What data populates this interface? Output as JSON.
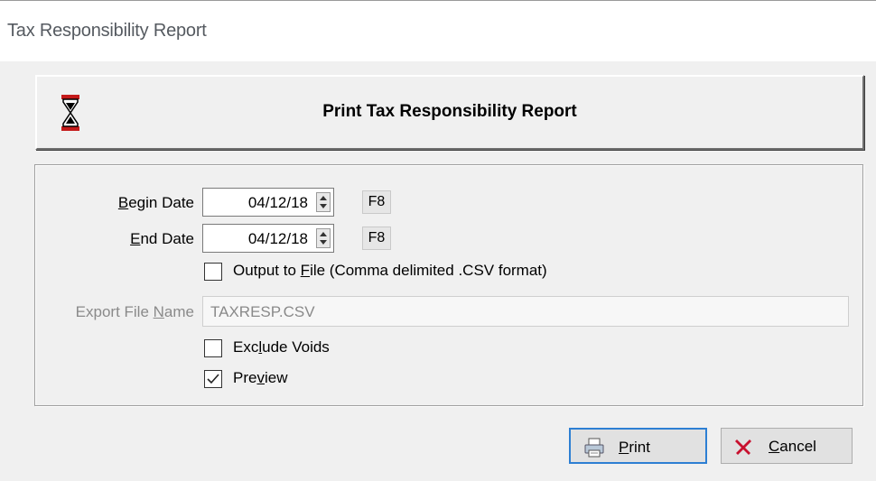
{
  "window": {
    "title": "Tax Responsibility Report"
  },
  "header_button": {
    "label": "Print Tax Responsibility Report",
    "icon": "hourglass-icon"
  },
  "form": {
    "begin_date": {
      "label_pre": "",
      "label_key": "B",
      "label_post": "egin Date",
      "value": "04/12/18",
      "shortcut": "F8"
    },
    "end_date": {
      "label_pre": "",
      "label_key": "E",
      "label_post": "nd Date",
      "value": "04/12/18",
      "shortcut": "F8"
    },
    "output_to_file": {
      "label_pre": "Output to ",
      "label_key": "F",
      "label_post": "ile (Comma delimited .CSV format)",
      "checked": false
    },
    "export_file_name": {
      "label_pre": "Export File ",
      "label_key": "N",
      "label_post": "ame",
      "value": "TAXRESP.CSV",
      "enabled": false
    },
    "exclude_voids": {
      "label_pre": "Exc",
      "label_key": "l",
      "label_post": "ude Voids",
      "checked": false
    },
    "preview": {
      "label_pre": "Pre",
      "label_key": "v",
      "label_post": "iew",
      "checked": true
    }
  },
  "buttons": {
    "print": {
      "label_pre": "",
      "label_key": "P",
      "label_post": "rint",
      "icon": "printer-icon"
    },
    "cancel": {
      "label_pre": "",
      "label_key": "C",
      "label_post": "ancel",
      "icon": "red-x-icon"
    }
  },
  "colors": {
    "accent_border": "#2d7fd3",
    "cancel_x": "#c8102e",
    "hourglass_red": "#c41a1a"
  }
}
